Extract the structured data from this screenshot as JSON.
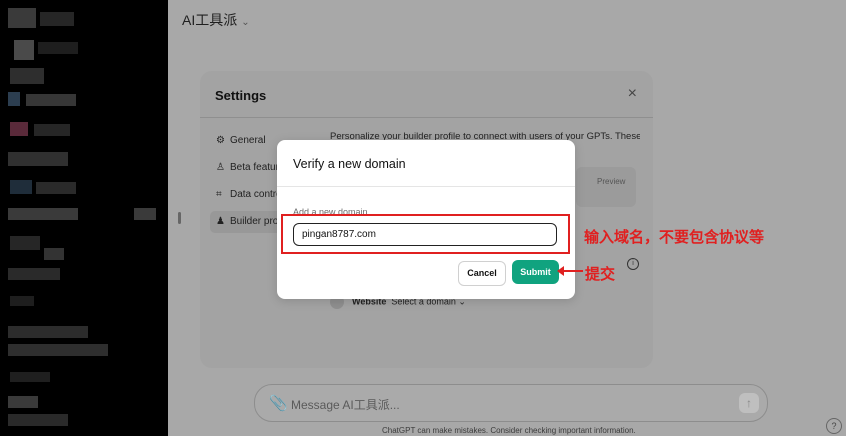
{
  "header": {
    "app_title": "AI工具派",
    "chevron": "⌄"
  },
  "settings": {
    "title": "Settings",
    "close": "×",
    "nav": [
      {
        "icon": "⚙",
        "label": "General"
      },
      {
        "icon": "♙",
        "label": "Beta features"
      },
      {
        "icon": "⌗",
        "label": "Data controls"
      },
      {
        "icon": "♟",
        "label": "Builder profile"
      }
    ],
    "description": "Personalize your builder profile to connect with users of your GPTs. These",
    "preview_label": "Preview",
    "website_label": "Website",
    "website_value": "Select a domain",
    "website_chevron": "⌄",
    "info": "i"
  },
  "dialog": {
    "title": "Verify a new domain",
    "field_label": "Add a new domain",
    "field_value": "pingan8787.com",
    "cancel_label": "Cancel",
    "submit_label": "Submit"
  },
  "annotations": {
    "input_note": "输入域名，不要包含协议等",
    "submit_note": "提交"
  },
  "composer": {
    "placeholder": "Message AI工具派...",
    "disclaimer": "ChatGPT can make mistakes. Consider checking important information.",
    "help": "?"
  },
  "colors": {
    "accent": "#10a37f",
    "annotation": "#e02020"
  }
}
